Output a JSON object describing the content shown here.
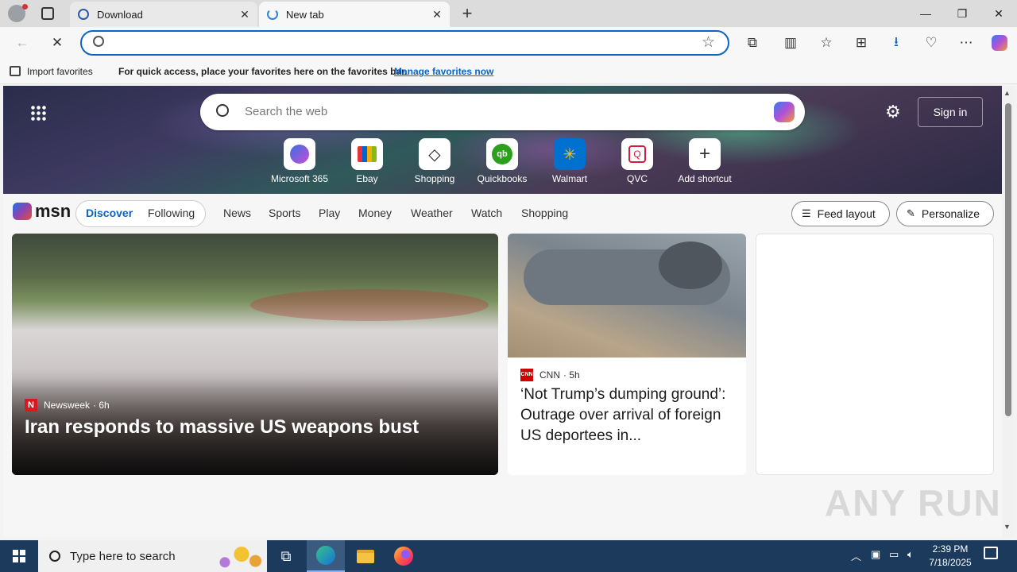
{
  "browser": {
    "tabs": [
      {
        "title": "Download"
      },
      {
        "title": "New tab"
      }
    ],
    "address_placeholder": ""
  },
  "favorites_bar": {
    "import_label": "Import favorites",
    "message": "For quick access, place your favorites here on the favorites bar.",
    "manage_link": "Manage favorites now"
  },
  "msn": {
    "search_placeholder": "Search the web",
    "sign_in": "Sign in",
    "shortcuts": [
      {
        "label": "Microsoft 365",
        "icon": "microsoft-365-icon"
      },
      {
        "label": "Ebay",
        "icon": "ebay-icon"
      },
      {
        "label": "Shopping",
        "icon": "shopping-tag-icon"
      },
      {
        "label": "Quickbooks",
        "icon": "quickbooks-icon"
      },
      {
        "label": "Walmart",
        "icon": "walmart-icon"
      },
      {
        "label": "QVC",
        "icon": "qvc-icon"
      },
      {
        "label": "Add shortcut",
        "icon": "plus-icon"
      }
    ],
    "logo_text": "msn",
    "discover": "Discover",
    "following": "Following",
    "nav_items": [
      "News",
      "Sports",
      "Play",
      "Money",
      "Weather",
      "Watch",
      "Shopping"
    ],
    "feed_layout": "Feed layout",
    "personalize": "Personalize"
  },
  "cards": {
    "main": {
      "source": "Newsweek",
      "age": "· 6h",
      "headline": "Iran responds to massive US weapons bust"
    },
    "second": {
      "source": "CNN",
      "age": "· 5h",
      "headline": "‘Not Trump’s dumping ground’: Outrage over arrival of foreign US deportees in..."
    }
  },
  "watermark": "ANY RUN",
  "taskbar": {
    "search_placeholder": "Type here to search",
    "time": "2:39 PM",
    "date": "7/18/2025"
  }
}
